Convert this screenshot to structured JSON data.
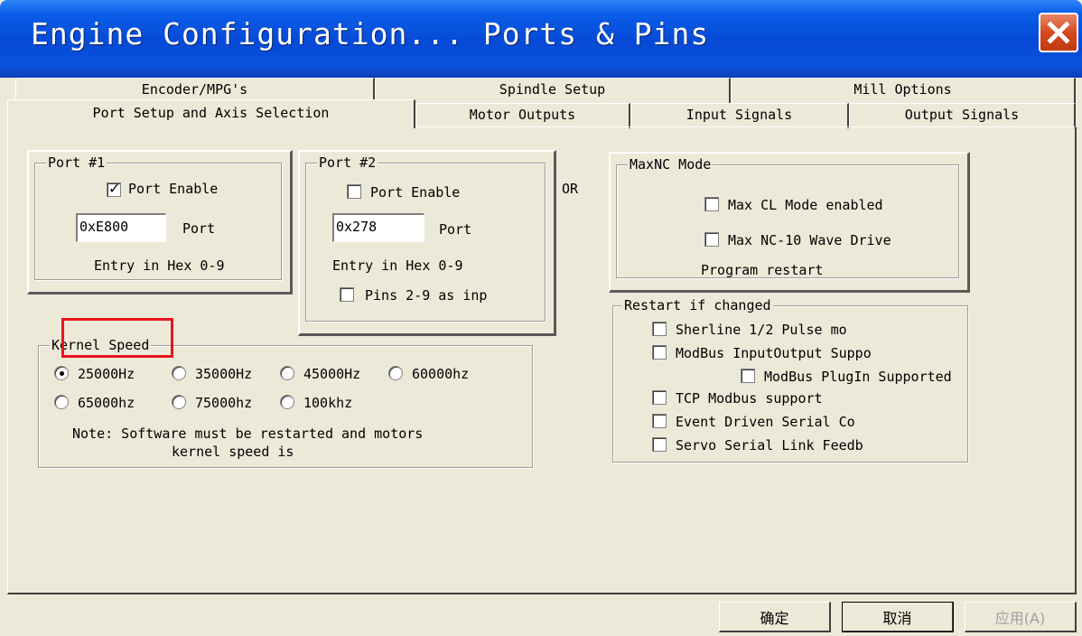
{
  "window": {
    "title": "Engine Configuration... Ports & Pins",
    "close_icon": "close-icon"
  },
  "tabs_row1": [
    {
      "label": "Encoder/MPG's"
    },
    {
      "label": "Spindle Setup"
    },
    {
      "label": "Mill Options"
    }
  ],
  "tabs_row2": [
    {
      "label": "Port Setup and Axis Selection",
      "active": true
    },
    {
      "label": "Motor Outputs"
    },
    {
      "label": "Input Signals"
    },
    {
      "label": "Output Signals"
    }
  ],
  "port1": {
    "legend": "Port #1",
    "enable_label": "Port Enable",
    "enabled": true,
    "address": "0xE800",
    "port_label": "Port",
    "hint": "Entry in Hex 0-9"
  },
  "port2": {
    "legend": "Port #2",
    "enable_label": "Port Enable",
    "enabled": false,
    "address": "0x278",
    "port_label": "Port",
    "hint": "Entry in Hex 0-9",
    "pins_label": "Pins 2-9 as inp",
    "pins_checked": false
  },
  "or_label": "OR",
  "maxnc": {
    "legend": "MaxNC Mode",
    "cl_mode_label": "Max CL Mode enabled",
    "wave_drive_label": "Max NC-10 Wave Drive",
    "program_restart": "Program restart"
  },
  "restart": {
    "legend": "Restart if changed",
    "options": [
      {
        "label": "Sherline 1/2 Pulse mo",
        "checked": false
      },
      {
        "label": "ModBus InputOutput Suppo",
        "checked": false
      },
      {
        "label": "ModBus PlugIn Supported",
        "checked": false
      },
      {
        "label": "TCP Modbus support",
        "checked": false
      },
      {
        "label": "Event Driven Serial Co",
        "checked": false
      },
      {
        "label": "Servo Serial Link Feedb",
        "checked": false
      }
    ]
  },
  "kernel": {
    "legend": "Kernel Speed",
    "options": [
      "25000Hz",
      "35000Hz",
      "45000Hz",
      "60000hz",
      "65000hz",
      "75000hz",
      "100khz"
    ],
    "selected": "25000Hz",
    "note_line1": "Note: Software must be restarted and motors",
    "note_line2": "kernel speed is"
  },
  "buttons": {
    "ok": "确定",
    "cancel": "取消",
    "apply": "应用(A)"
  },
  "colors": {
    "titlebar": "#0649D6",
    "window_bg": "#ECE9D8",
    "highlight": "#E8141C",
    "close_button": "#D5491F"
  }
}
